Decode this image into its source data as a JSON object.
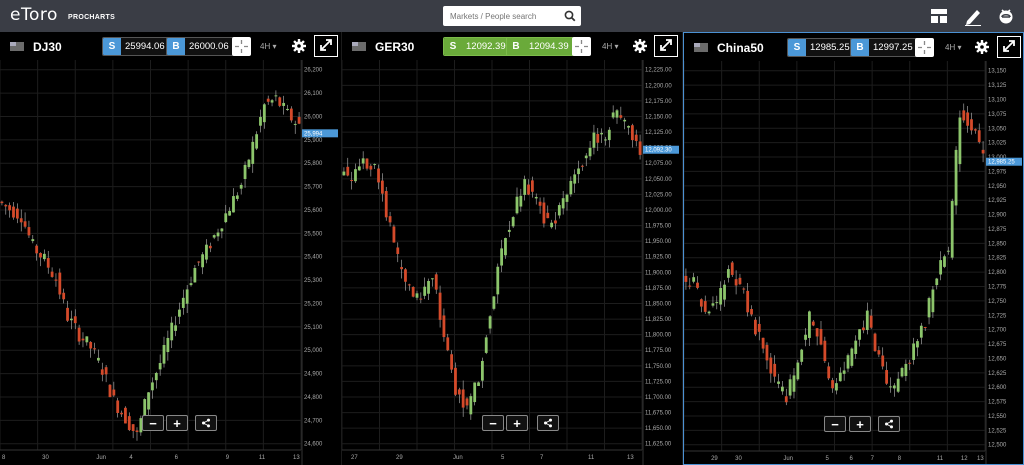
{
  "app": {
    "logo": "eToro",
    "logo_sub": "PROCHARTS"
  },
  "search": {
    "placeholder": "Markets / People search"
  },
  "icons": [
    "search-icon",
    "layout-icon",
    "pencil-icon",
    "etoro-icon",
    "gear-icon",
    "expand-icon",
    "crosshair-icon",
    "share-icon"
  ],
  "colors": {
    "up": "#8cc56b",
    "down": "#d44a2a",
    "sell_bg": "#4b98d8",
    "buy_green": "#6aaa3a",
    "active_border": "#4b91d3"
  },
  "panels": [
    {
      "symbol": "DJ30",
      "sell": {
        "label": "S",
        "value": "25994.06"
      },
      "buy": {
        "label": "B",
        "value": "26000.06"
      },
      "timeframe": "4H",
      "green_buttons": false,
      "active": false,
      "price_marker": "25,994",
      "zoom_out": "−",
      "zoom_in": "+",
      "chart_data": {
        "type": "candlestick",
        "ylim": [
          24600,
          26300
        ],
        "y_ticks": [
          "26,200",
          "26,100",
          "26,000",
          "25,900",
          "25,800",
          "25,700",
          "25,600",
          "25,500",
          "25,400",
          "25,300",
          "25,200",
          "25,100",
          "25,000",
          "24,900",
          "24,800",
          "24,700",
          "24,600"
        ],
        "x_ticks": [
          "8",
          "30",
          "Jun",
          "4",
          "6",
          "9",
          "11",
          "13"
        ],
        "x_tick_at": [
          0.0,
          0.14,
          0.32,
          0.43,
          0.58,
          0.75,
          0.86,
          0.98
        ],
        "close": [
          25650,
          25620,
          25480,
          25420,
          25330,
          25160,
          25080,
          25020,
          24920,
          24780,
          24700,
          24620,
          24830,
          24950,
          25100,
          25250,
          25380,
          25460,
          25560,
          25660,
          25760,
          25940,
          26120,
          26150,
          26080,
          26030
        ],
        "last": 25994
      }
    },
    {
      "symbol": "GER30",
      "sell": {
        "label": "S",
        "value": "12092.39"
      },
      "buy": {
        "label": "B",
        "value": "12094.39"
      },
      "timeframe": "4H",
      "green_buttons": true,
      "active": false,
      "price_marker": "12,092.30",
      "zoom_out": "−",
      "zoom_in": "+",
      "chart_data": {
        "type": "candlestick",
        "ylim": [
          11615,
          12230
        ],
        "y_ticks": [
          "12,225.00",
          "12,200.00",
          "12,175.00",
          "12,150.00",
          "12,125.00",
          "12,100.00",
          "12,075.00",
          "12,050.00",
          "12,025.00",
          "12,000.00",
          "11,975.00",
          "11,950.00",
          "11,925.00",
          "11,900.00",
          "11,875.00",
          "11,850.00",
          "11,825.00",
          "11,800.00",
          "11,775.00",
          "11,750.00",
          "11,725.00",
          "11,700.00",
          "11,675.00",
          "11,650.00",
          "11,625.00"
        ],
        "x_ticks": [
          "27",
          "29",
          "Jun",
          "5",
          "7",
          "11",
          "13"
        ],
        "x_tick_at": [
          0.03,
          0.18,
          0.37,
          0.53,
          0.66,
          0.82,
          0.95
        ],
        "close": [
          12050,
          12080,
          12060,
          11990,
          11910,
          11860,
          11840,
          11890,
          11780,
          11700,
          11660,
          11720,
          11830,
          11930,
          11990,
          12040,
          12010,
          11970,
          11990,
          12040,
          12070,
          12110,
          12120,
          12160,
          12130,
          12090
        ],
        "last": 12092.3
      }
    },
    {
      "symbol": "China50",
      "sell": {
        "label": "S",
        "value": "12985.25"
      },
      "buy": {
        "label": "B",
        "value": "12997.25"
      },
      "timeframe": "4H",
      "green_buttons": false,
      "active": true,
      "price_marker": "12,985.25",
      "zoom_out": "−",
      "zoom_in": "+",
      "chart_data": {
        "type": "candlestick",
        "ylim": [
          12470,
          13160
        ],
        "y_ticks": [
          "13,150",
          "13,125",
          "13,100",
          "13,075",
          "13,050",
          "13,025",
          "13,000",
          "12,975",
          "12,950",
          "12,925",
          "12,900",
          "12,875",
          "12,850",
          "12,825",
          "12,800",
          "12,775",
          "12,750",
          "12,725",
          "12,700",
          "12,675",
          "12,650",
          "12,625",
          "12,600",
          "12,575",
          "12,550",
          "12,525",
          "12,500"
        ],
        "x_ticks": [
          "29",
          "30",
          "Jun",
          "5",
          "6",
          "7",
          "8",
          "11",
          "12",
          "13"
        ],
        "x_tick_at": [
          0.09,
          0.17,
          0.33,
          0.47,
          0.55,
          0.62,
          0.71,
          0.84,
          0.92,
          0.99
        ],
        "close": [
          12760,
          12700,
          12720,
          12790,
          12760,
          12700,
          12640,
          12580,
          12550,
          12620,
          12700,
          12650,
          12560,
          12600,
          12660,
          12700,
          12620,
          12560,
          12600,
          12640,
          12690,
          12780,
          12820,
          13080,
          13050,
          12990
        ],
        "last": 12985.25
      }
    }
  ]
}
